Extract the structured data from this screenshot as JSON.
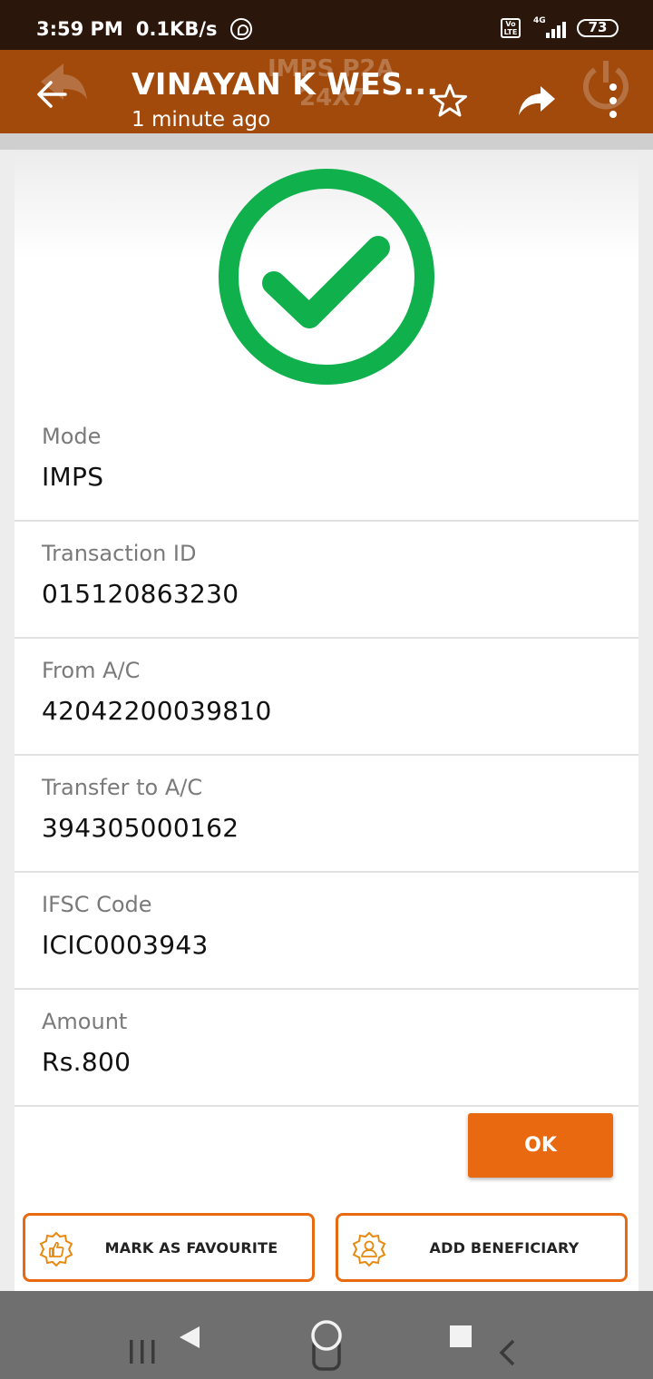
{
  "status_bar": {
    "time": "3:59 PM",
    "speed": "0.1KB/s",
    "volte": "Vo LTE",
    "network": "4G",
    "battery": "73",
    "icons": [
      "whatsapp-icon",
      "volte-icon",
      "signal-icon",
      "battery-icon"
    ]
  },
  "header": {
    "title": "VINAYAN K WES...",
    "subtitle": "1 minute ago",
    "ghost_line1": "IMPS P2A",
    "ghost_line2": "24X7",
    "icons": [
      "back-arrow-icon",
      "star-icon",
      "share-icon",
      "more-vert-icon"
    ]
  },
  "success_icon": "check-circle-icon",
  "details": [
    {
      "label": "Mode",
      "value": "IMPS"
    },
    {
      "label": "Transaction ID",
      "value": "015120863230"
    },
    {
      "label": "From A/C",
      "value": "42042200039810"
    },
    {
      "label": "Transfer to A/C",
      "value": "394305000162"
    },
    {
      "label": "IFSC Code",
      "value": "ICIC0003943"
    },
    {
      "label": "Amount",
      "value": "Rs.800"
    }
  ],
  "ok_label": "OK",
  "actions": {
    "favourite_label": "MARK AS FAVOURITE",
    "beneficiary_label": "ADD BENEFICIARY"
  },
  "colors": {
    "header_bg": "#a14a0c",
    "accent": "#e8690f",
    "success": "#10b04c"
  },
  "nav_icons": [
    "recent-apps-icon",
    "back-triangle-icon",
    "home-icon",
    "overview-square-icon",
    "back-chevron-icon"
  ]
}
